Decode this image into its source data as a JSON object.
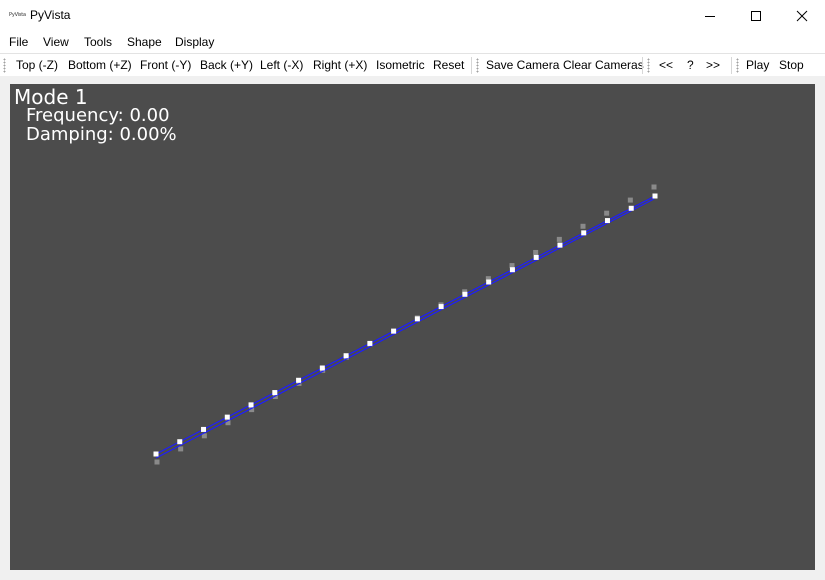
{
  "window": {
    "title": "PyVista",
    "icon_text": "PyVista"
  },
  "menu": [
    "File",
    "View",
    "Tools",
    "Shape",
    "Display"
  ],
  "toolbar": {
    "views": [
      "Top (-Z)",
      "Bottom (+Z)",
      "Front (-Y)",
      "Back (+Y)",
      "Left (-X)",
      "Right (+X)",
      "Isometric",
      "Reset"
    ],
    "camera": [
      "Save Camera",
      "Clear Cameras"
    ],
    "nav": [
      "<<",
      "?",
      ">>"
    ],
    "playback": [
      "Play",
      "Stop"
    ]
  },
  "overlay": {
    "mode": "Mode 1",
    "frequency": "Frequency: 0.00",
    "damping": "Damping: 0.00%"
  },
  "colors": {
    "viewport_bg": "#4c4c4c",
    "line": "#1d1dff",
    "node": "#ffffff",
    "ghost_node": "#8a8a8a"
  },
  "icons": {
    "minimize": "minimize-icon",
    "maximize": "maximize-icon",
    "close": "close-icon"
  }
}
